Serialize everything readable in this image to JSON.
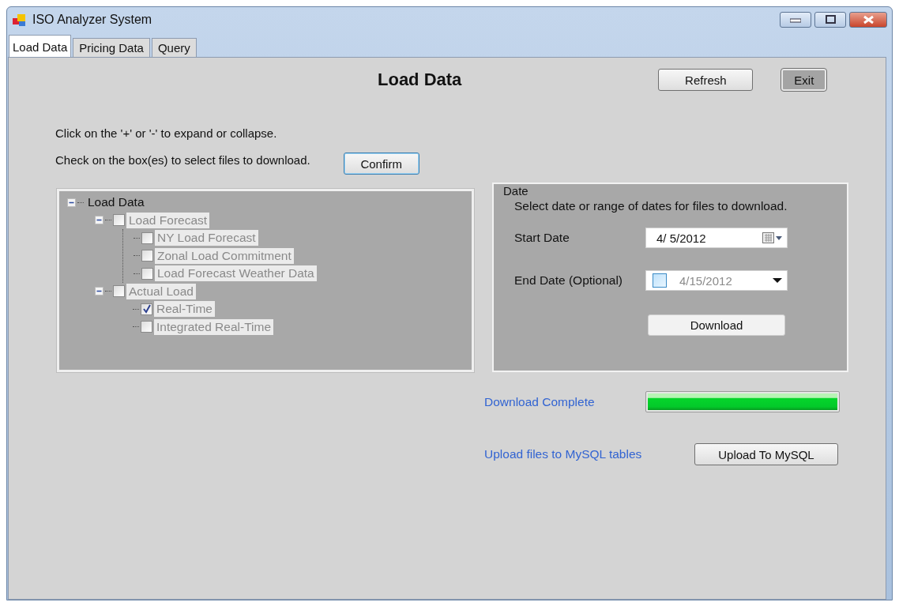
{
  "window": {
    "title": "ISO Analyzer System"
  },
  "tabs": [
    {
      "label": "Load Data",
      "selected": true
    },
    {
      "label": "Pricing Data",
      "selected": false
    },
    {
      "label": "Query",
      "selected": false
    }
  ],
  "heading": "Load Data",
  "header_buttons": [
    {
      "label": "Refresh",
      "pressed": false
    },
    {
      "label": "Exit",
      "pressed": true
    }
  ],
  "instructions": [
    "Click on the '+' or '-' to expand or collapse.",
    "Check on the box(es) to select files to download."
  ],
  "confirm_button": {
    "label": "Confirm",
    "focused": true
  },
  "tree": [
    {
      "label": "Load Data",
      "expanded": true,
      "disabled": false,
      "children": [
        {
          "label": "Load Forecast",
          "expanded": true,
          "checked": false,
          "disabled": true,
          "children": [
            {
              "label": "NY Load Forecast",
              "checked": false,
              "disabled": true
            },
            {
              "label": "Zonal Load Commitment",
              "checked": false,
              "disabled": true
            },
            {
              "label": "Load Forecast Weather Data",
              "checked": false,
              "disabled": true
            }
          ]
        },
        {
          "label": "Actual Load",
          "expanded": true,
          "checked": false,
          "disabled": true,
          "children": [
            {
              "label": "Real-Time",
              "checked": true,
              "disabled": true
            },
            {
              "label": "Integrated Real-Time",
              "checked": false,
              "disabled": true
            }
          ]
        }
      ]
    }
  ],
  "date_group": {
    "title": "Date",
    "hint": "Select date or range of dates for files to download.",
    "fields": [
      {
        "label": "Start Date",
        "kind": "calendar",
        "value": "4/ 5/2012"
      },
      {
        "label": "End Date (Optional)",
        "kind": "optional",
        "checked": false,
        "value": "4/15/2012"
      }
    ],
    "download_button": "Download"
  },
  "download_status": {
    "label": "Download Complete",
    "level": 1.0
  },
  "upload": {
    "label": "Upload files to MySQL tables",
    "button": "Upload To MySQL"
  }
}
